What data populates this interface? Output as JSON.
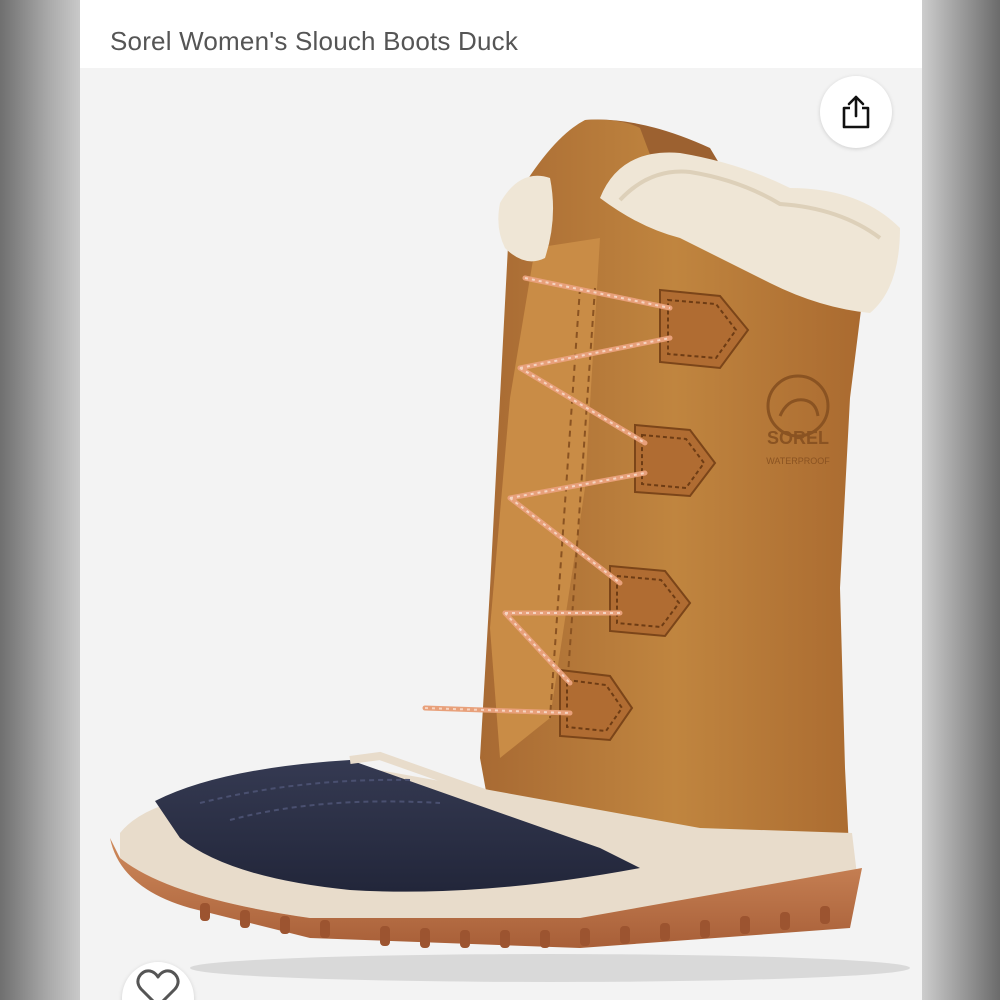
{
  "header": {
    "title": "Sorel Women's Slouch Boots Duck"
  },
  "product_image": {
    "subject": "boot-photo",
    "brand_mark": "SOREL",
    "brand_tag": "WATERPROOF"
  },
  "actions": {
    "share_icon": "share-icon",
    "like_icon": "heart-icon"
  },
  "colors": {
    "leather": "#b87a3f",
    "fur": "#efe6d6",
    "rubber": "#2b2f45",
    "sole": "#c27a52",
    "midsole": "#e8dccb"
  }
}
